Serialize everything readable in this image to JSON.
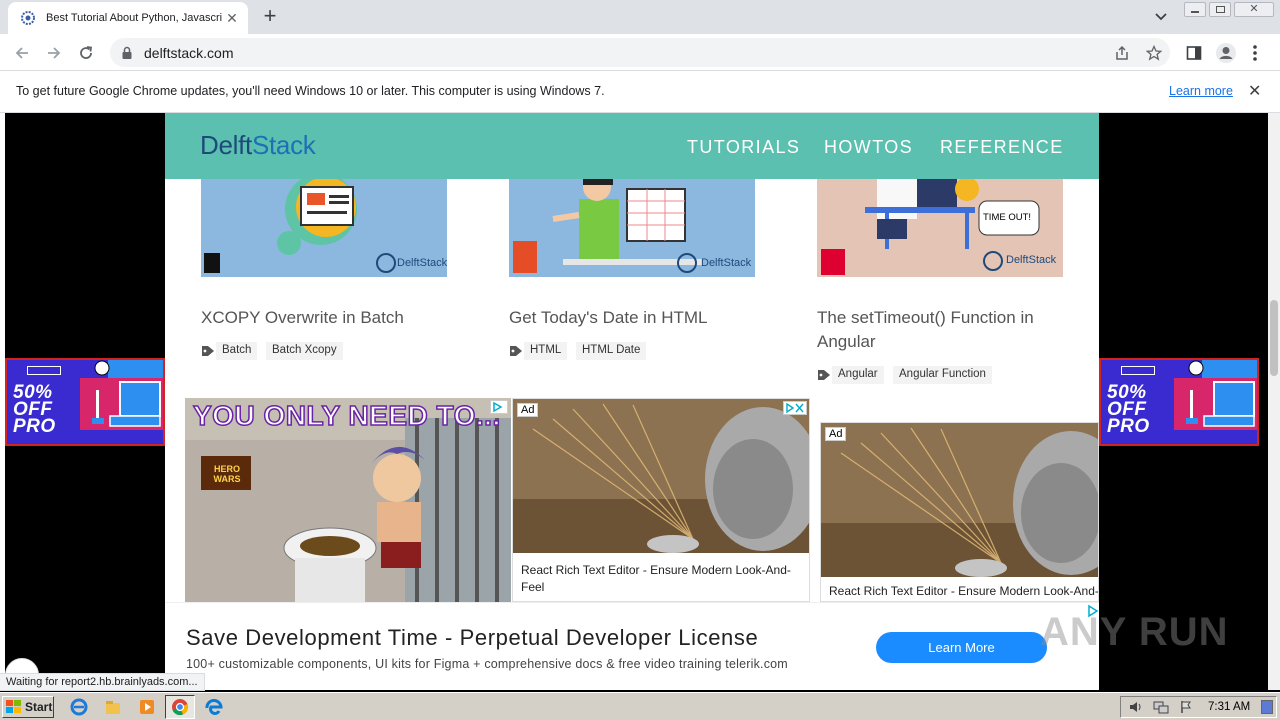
{
  "browser": {
    "tab_title": "Best Tutorial About Python, Javascri",
    "url": "delftstack.com"
  },
  "infobar": {
    "message": "To get future Google Chrome updates, you'll need Windows 10 or later. This computer is using Windows 7.",
    "link": "Learn more"
  },
  "site": {
    "logo_prefix": "Delft",
    "logo_suffix": "Stack",
    "nav": [
      "TUTORIALS",
      "HOWTOS",
      "REFERENCE"
    ],
    "thumb_brand": "DelftStack",
    "timeout_bubble": "TIME OUT!",
    "cards": [
      {
        "title": "XCOPY Overwrite in Batch",
        "tags": [
          "Batch",
          "Batch Xcopy"
        ]
      },
      {
        "title": "Get Today's Date in HTML",
        "tags": [
          "HTML",
          "HTML Date"
        ]
      },
      {
        "title": "The setTimeout() Function in Angular",
        "tags": [
          "Angular",
          "Angular Function"
        ]
      }
    ]
  },
  "ads": {
    "game_headline": "YOU ONLY NEED TO...",
    "game_logo": "HERO WARS",
    "ad_label": "Ad",
    "editor_caption": "React Rich Text Editor - Ensure Modern Look-And-Feel",
    "side_pct": "50%",
    "side_off": "OFF",
    "side_pro": "PRO",
    "banner_headline": "Save Development Time - Perpetual Developer License",
    "banner_sub": "100+ customizable components, UI kits for Figma + comprehensive docs & free video training telerik.com",
    "banner_button": "Learn More"
  },
  "watermark": "ANY RUN",
  "status_text": "Waiting for report2.hb.brainlyads.com...",
  "taskbar": {
    "start": "Start",
    "clock": "7:31 AM"
  }
}
